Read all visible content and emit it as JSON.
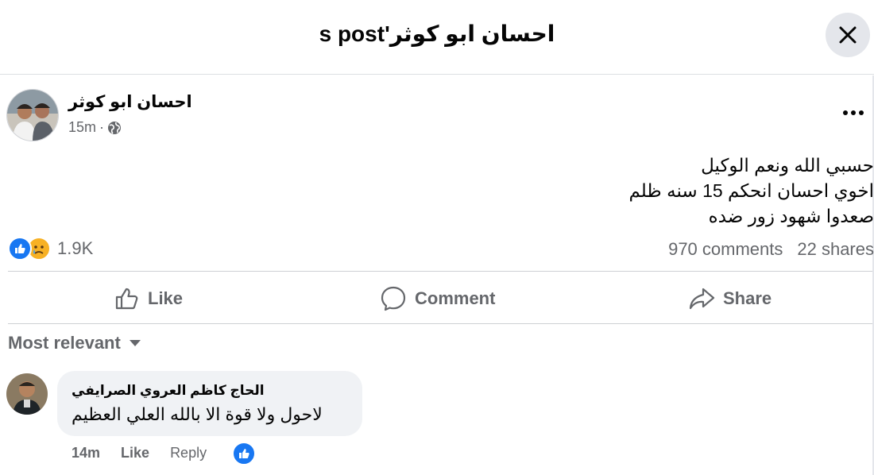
{
  "header": {
    "title": "احسان ابو كوثر's post"
  },
  "post": {
    "author": "احسان ابو كوثر",
    "time": "15m",
    "separator": "·",
    "body_lines": [
      "حسبي الله ونعم الوكيل",
      "اخوي احسان انحكم 15 سنه ظلم",
      "صعدوا شهود زور ضده"
    ],
    "reaction_count": "1.9K",
    "comments_count": "970 comments",
    "shares_count": "22 shares"
  },
  "actions": {
    "like": "Like",
    "comment": "Comment",
    "share": "Share"
  },
  "sort": {
    "label": "Most relevant"
  },
  "comment": {
    "author": "الحاج كاظم العروي الصرايفي",
    "text": "لاحول ولا قوة الا بالله العلي العظيم",
    "time": "14m",
    "like": "Like",
    "reply": "Reply"
  },
  "colors": {
    "accent": "#1877f2",
    "secondary_text": "#65676b",
    "bubble": "#f0f2f5"
  },
  "icons": [
    "close-icon",
    "globe-icon",
    "more-icon",
    "like-reaction-icon",
    "sad-reaction-icon",
    "thumbs-up-icon",
    "comment-icon",
    "share-icon",
    "caret-down-icon"
  ]
}
